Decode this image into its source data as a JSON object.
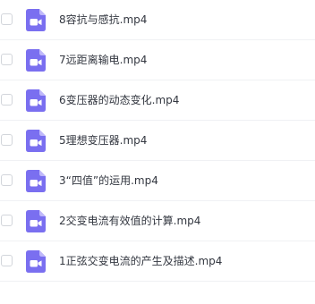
{
  "file_list": {
    "items": [
      {
        "name": "8容抗与感抗.mp4",
        "type_icon": "video-file-icon"
      },
      {
        "name": "7远距离输电.mp4",
        "type_icon": "video-file-icon"
      },
      {
        "name": "6变压器的动态变化.mp4",
        "type_icon": "video-file-icon"
      },
      {
        "name": "5理想变压器.mp4",
        "type_icon": "video-file-icon"
      },
      {
        "name": "3“四值”的运用.mp4",
        "type_icon": "video-file-icon"
      },
      {
        "name": "2交变电流有效值的计算.mp4",
        "type_icon": "video-file-icon"
      },
      {
        "name": "1正弦交变电流的产生及描述.mp4",
        "type_icon": "video-file-icon"
      }
    ]
  },
  "colors": {
    "icon_fill": "#7a6ff0",
    "icon_fold": "#bfb8fa",
    "text": "#333740",
    "divider": "#f0f1f4"
  }
}
